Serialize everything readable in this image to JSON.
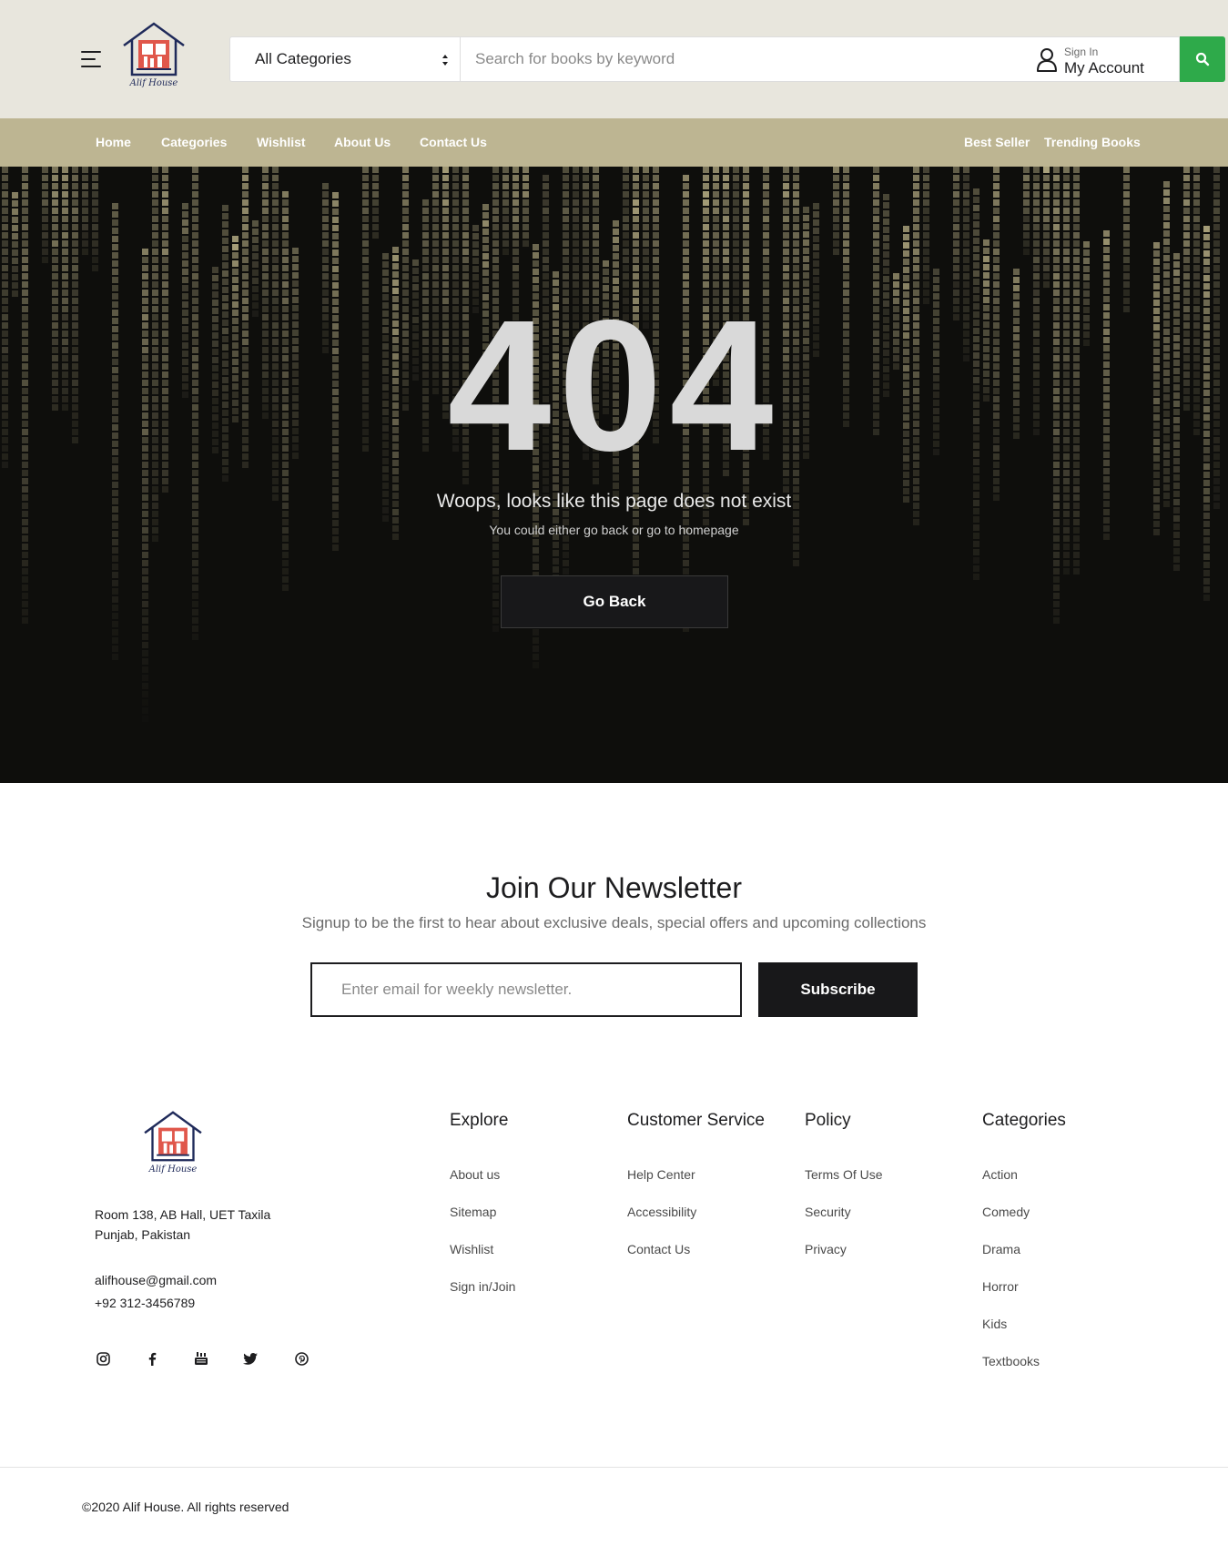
{
  "brand": {
    "name": "Alif House",
    "accent": "#2eaa4a",
    "nav_bg": "#bdb592",
    "header_bg": "#e8e6dd"
  },
  "header": {
    "category_select": "All Categories",
    "search_placeholder": "Search for books by keyword",
    "account_small": "Sign In",
    "account_big": "My Account"
  },
  "nav": {
    "items": [
      "Home",
      "Categories",
      "Wishlist",
      "About Us",
      "Contact Us"
    ],
    "right_items": [
      "Best Seller",
      "Trending Books"
    ]
  },
  "hero": {
    "code": "404",
    "title": "Woops, looks like this page does not exist",
    "subtitle": "You could either go back or go to homepage",
    "button": "Go Back"
  },
  "newsletter": {
    "title": "Join Our Newsletter",
    "subtitle": "Signup to be the first to hear about exclusive deals, special offers and upcoming collections",
    "placeholder": "Enter email for weekly newsletter.",
    "button": "Subscribe"
  },
  "footer": {
    "address_line1": "Room 138, AB Hall, UET Taxila",
    "address_line2": "Punjab, Pakistan",
    "email": "alifhouse@gmail.com",
    "phone": "+92 312-3456789",
    "socials": [
      "instagram-icon",
      "facebook-icon",
      "youtube-icon",
      "twitter-icon",
      "pinterest-icon"
    ],
    "columns": [
      {
        "title": "Explore",
        "links": [
          "About us",
          "Sitemap",
          "Wishlist",
          "Sign in/Join"
        ]
      },
      {
        "title": "Customer Service",
        "links": [
          "Help Center",
          "Accessibility",
          "Contact Us"
        ]
      },
      {
        "title": "Policy",
        "links": [
          "Terms Of Use",
          "Security",
          "Privacy"
        ]
      },
      {
        "title": "Categories",
        "links": [
          "Action",
          "Comedy",
          "Drama",
          "Horror",
          "Kids",
          "Textbooks"
        ]
      }
    ],
    "copyright": "©2020 Alif House. All rights reserved"
  }
}
